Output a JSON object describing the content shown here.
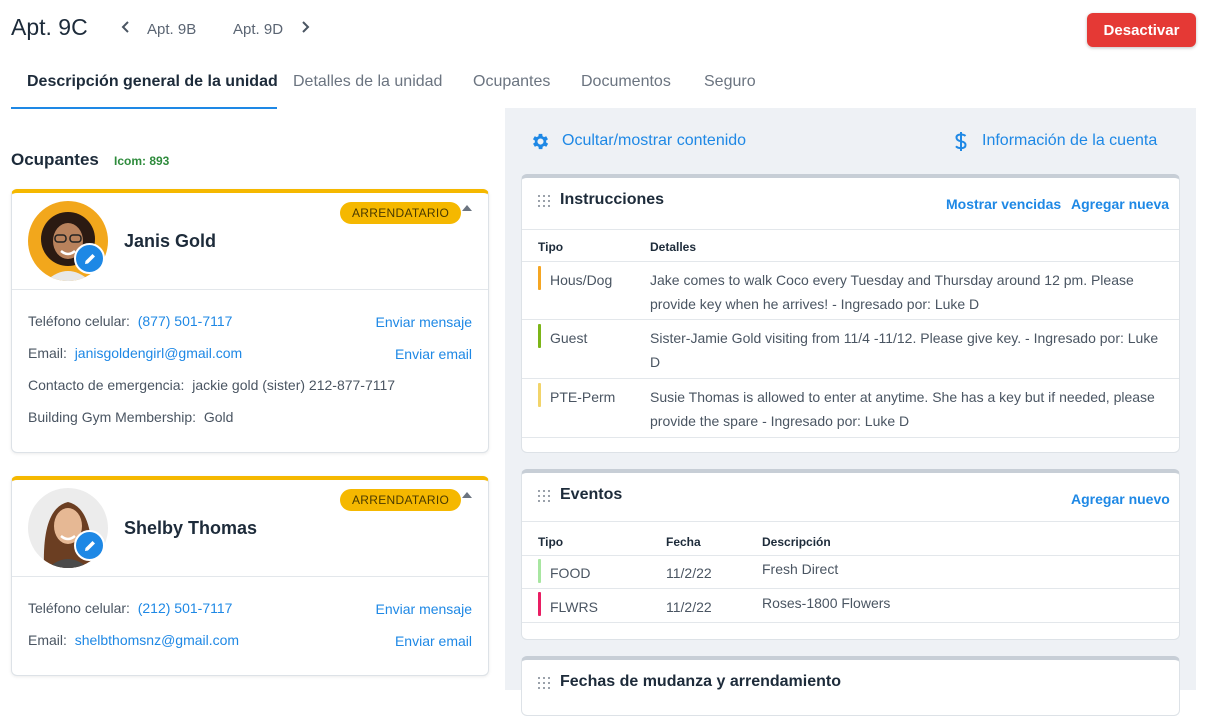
{
  "header": {
    "unit": "Apt. 9C",
    "prev_unit": "Apt. 9B",
    "next_unit": "Apt. 9D",
    "deactivate_label": "Desactivar"
  },
  "tabs": [
    {
      "label": "Descripción general de la unidad",
      "active": true
    },
    {
      "label": "Detalles de la unidad",
      "active": false
    },
    {
      "label": "Ocupantes",
      "active": false
    },
    {
      "label": "Documentos",
      "active": false
    },
    {
      "label": "Seguro",
      "active": false
    }
  ],
  "occupants_section": {
    "heading": "Ocupantes",
    "icom": "Icom: 893",
    "occupants": [
      {
        "name": "Janis Gold",
        "badge": "ARRENDATARIO",
        "phone_label": "Teléfono celular:",
        "phone": "(877) 501-7117",
        "send_message": "Enviar mensaje",
        "email_label": "Email:",
        "email": "janisgoldengirl@gmail.com",
        "send_email": "Enviar email",
        "emergency_label": "Contacto de emergencia:",
        "emergency": "jackie gold (sister) 212-877-7117",
        "gym_label": "Building Gym Membership:",
        "gym": "Gold"
      },
      {
        "name": "Shelby Thomas",
        "badge": "ARRENDATARIO",
        "phone_label": "Teléfono celular:",
        "phone": "(212) 501-7117",
        "send_message": "Enviar mensaje",
        "email_label": "Email:",
        "email": "shelbthomsnz@gmail.com",
        "send_email": "Enviar email"
      }
    ]
  },
  "right": {
    "toggle_content": "Ocultar/mostrar contenido",
    "account_info": "Información de la cuenta",
    "instructions": {
      "title": "Instrucciones",
      "show_expired": "Mostrar vencidas",
      "add_new": "Agregar nueva",
      "col_type": "Tipo",
      "col_details": "Detalles",
      "rows": [
        {
          "type": "Hous/Dog",
          "details": "Jake comes to walk Coco every Tuesday and Thursday around 12 pm. Please provide key when he arrives!  - Ingresado por: Luke D",
          "color": "#f5a623"
        },
        {
          "type": "Guest",
          "details": "Sister-Jamie Gold visiting from 11/4 -11/12. Please give key.  - Ingresado por: Luke D",
          "color": "#7cb518"
        },
        {
          "type": "PTE-Perm",
          "details": "Susie Thomas is allowed to enter at anytime. She has a key but if needed, please provide the spare  - Ingresado por: Luke D",
          "color": "#f2d46a"
        }
      ]
    },
    "events": {
      "title": "Eventos",
      "add_new": "Agregar nuevo",
      "col_type": "Tipo",
      "col_date": "Fecha",
      "col_desc": "Descripción",
      "rows": [
        {
          "type": "FOOD",
          "date": "11/2/22",
          "desc": "Fresh Direct",
          "color": "#a8e6a1"
        },
        {
          "type": "FLWRS",
          "date": "11/2/22",
          "desc": "Roses-1800 Flowers",
          "color": "#e91e63"
        }
      ]
    },
    "move_dates": {
      "title": "Fechas de mudanza y arrendamiento"
    }
  }
}
